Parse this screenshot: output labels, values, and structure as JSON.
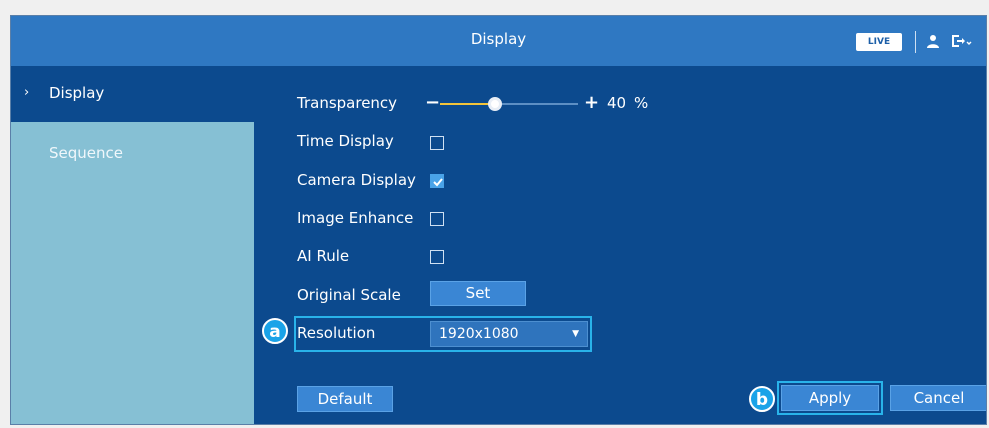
{
  "window": {
    "title": "Display",
    "live_label": "LIVE"
  },
  "sidebar": {
    "items": [
      {
        "label": "Display",
        "active": true
      },
      {
        "label": "Sequence",
        "active": false
      }
    ]
  },
  "settings": {
    "transparency": {
      "label": "Transparency",
      "value": "40",
      "unit": "%",
      "level_percent": 40
    },
    "time_display": {
      "label": "Time Display",
      "checked": false
    },
    "camera_display": {
      "label": "Camera Display",
      "checked": true
    },
    "image_enhance": {
      "label": "Image Enhance",
      "checked": false
    },
    "ai_rule": {
      "label": "AI Rule",
      "checked": false
    },
    "original_scale": {
      "label": "Original Scale",
      "button_label": "Set"
    },
    "resolution": {
      "label": "Resolution",
      "value": "1920x1080"
    }
  },
  "annotations": {
    "a": "a",
    "b": "b"
  },
  "buttons": {
    "default": "Default",
    "apply": "Apply",
    "cancel": "Cancel"
  },
  "colors": {
    "panel": "#0c4a8e",
    "titlebar": "#2f78c2",
    "button": "#3a86d4",
    "highlight": "#29b3ea",
    "slider_fill": "#f3c43a"
  }
}
